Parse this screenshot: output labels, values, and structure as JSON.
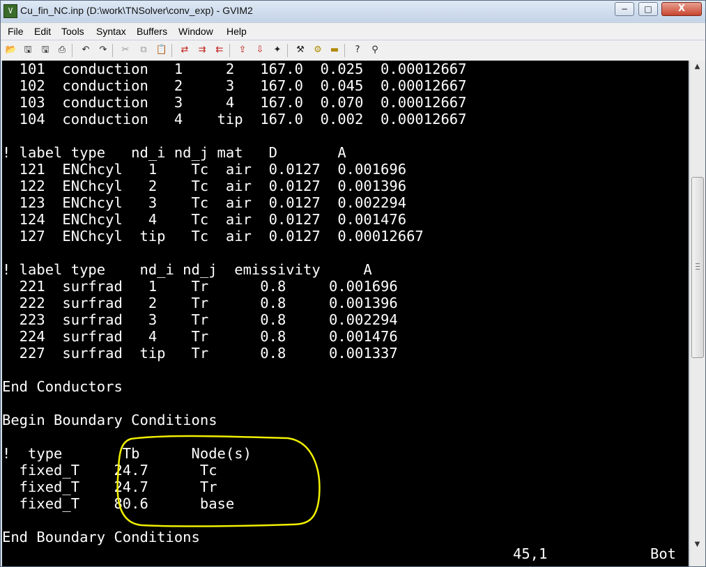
{
  "window": {
    "title": "Cu_fin_NC.inp (D:\\work\\TNSolver\\conv_exp) - GVIM2",
    "buttons": {
      "minimize": "−",
      "maximize": "□",
      "close": "X"
    }
  },
  "menu": [
    "File",
    "Edit",
    "Tools",
    "Syntax",
    "Buffers",
    "Window",
    "Help"
  ],
  "toolbar": [
    {
      "icon": "open-icon",
      "glyph": "📂",
      "tone": ""
    },
    {
      "icon": "save-icon",
      "glyph": "🖫",
      "tone": ""
    },
    {
      "icon": "save-all-icon",
      "glyph": "🖫",
      "tone": ""
    },
    {
      "icon": "print-icon",
      "glyph": "⎙",
      "tone": ""
    },
    {
      "icon": "undo-icon",
      "glyph": "↶",
      "tone": ""
    },
    {
      "icon": "redo-icon",
      "glyph": "↷",
      "tone": ""
    },
    {
      "icon": "cut-icon",
      "glyph": "✂",
      "tone": "grey"
    },
    {
      "icon": "copy-icon",
      "glyph": "⧉",
      "tone": "grey"
    },
    {
      "icon": "paste-icon",
      "glyph": "📋",
      "tone": ""
    },
    {
      "icon": "replace-icon",
      "glyph": "⇄",
      "tone": "red"
    },
    {
      "icon": "find-next-icon",
      "glyph": "⇉",
      "tone": "red"
    },
    {
      "icon": "find-prev-icon",
      "glyph": "⇇",
      "tone": "red"
    },
    {
      "icon": "load-session-icon",
      "glyph": "⇪",
      "tone": "red"
    },
    {
      "icon": "save-session-icon",
      "glyph": "⇩",
      "tone": "red"
    },
    {
      "icon": "run-script-icon",
      "glyph": "✦",
      "tone": ""
    },
    {
      "icon": "make-icon",
      "glyph": "⚒",
      "tone": ""
    },
    {
      "icon": "shell-icon",
      "glyph": "⚙",
      "tone": "yellow"
    },
    {
      "icon": "ctags-icon",
      "glyph": "▬",
      "tone": "yellow"
    },
    {
      "icon": "help-icon",
      "glyph": "?",
      "tone": ""
    },
    {
      "icon": "find-help-icon",
      "glyph": "⚲",
      "tone": ""
    }
  ],
  "editor": {
    "lines": [
      "  101  conduction   1     2   167.0  0.025  0.00012667",
      "  102  conduction   2     3   167.0  0.045  0.00012667",
      "  103  conduction   3     4   167.0  0.070  0.00012667",
      "  104  conduction   4    tip  167.0  0.002  0.00012667",
      "",
      "! label type   nd_i nd_j mat   D       A",
      "  121  ENChcyl   1    Tc  air  0.0127  0.001696",
      "  122  ENChcyl   2    Tc  air  0.0127  0.001396",
      "  123  ENChcyl   3    Tc  air  0.0127  0.002294",
      "  124  ENChcyl   4    Tc  air  0.0127  0.001476",
      "  127  ENChcyl  tip   Tc  air  0.0127  0.00012667",
      "",
      "! label type    nd_i nd_j  emissivity     A",
      "  221  surfrad   1    Tr      0.8     0.001696",
      "  222  surfrad   2    Tr      0.8     0.001396",
      "  223  surfrad   3    Tr      0.8     0.002294",
      "  224  surfrad   4    Tr      0.8     0.001476",
      "  227  surfrad  tip   Tr      0.8     0.001337",
      "",
      "End Conductors",
      "",
      "Begin Boundary Conditions",
      "",
      "!  type       Tb      Node(s)",
      "  fixed_T    24.7      Tc",
      "  fixed_T    24.7      Tr",
      "  fixed_T    80.6      base",
      "",
      "End Boundary Conditions"
    ],
    "cursor_position": "45,1",
    "scroll_indicator": "Bot"
  },
  "colors": {
    "editor_bg": "#000000",
    "editor_fg": "#ffffff",
    "annotation": "#f0f000"
  }
}
